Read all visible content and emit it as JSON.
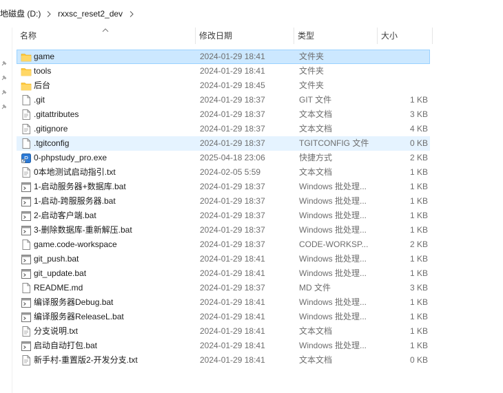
{
  "breadcrumb": {
    "drive": "地磁盘 (D:)",
    "folder": "rxxsc_reset2_dev"
  },
  "columns": {
    "name": "名称",
    "date": "修改日期",
    "type": "类型",
    "size": "大小"
  },
  "sort": {
    "column": "name",
    "direction": "ascending"
  },
  "colors": {
    "selected_bg": "#cce8ff",
    "selected_border": "#99d1ff",
    "hover_bg": "#e5f3ff",
    "folder": "#ffc83d"
  },
  "files": [
    {
      "name": "game",
      "date": "2024-01-29 18:41",
      "type": "文件夹",
      "size": "",
      "icon": "folder-icon",
      "state": "selected"
    },
    {
      "name": "tools",
      "date": "2024-01-29 18:41",
      "type": "文件夹",
      "size": "",
      "icon": "folder-icon",
      "state": ""
    },
    {
      "name": "后台",
      "date": "2024-01-29 18:45",
      "type": "文件夹",
      "size": "",
      "icon": "folder-icon",
      "state": ""
    },
    {
      "name": ".git",
      "date": "2024-01-29 18:37",
      "type": "GIT 文件",
      "size": "1 KB",
      "icon": "file-icon",
      "state": ""
    },
    {
      "name": ".gitattributes",
      "date": "2024-01-29 18:37",
      "type": "文本文档",
      "size": "3 KB",
      "icon": "text-file-icon",
      "state": ""
    },
    {
      "name": ".gitignore",
      "date": "2024-01-29 18:37",
      "type": "文本文档",
      "size": "4 KB",
      "icon": "text-file-icon",
      "state": ""
    },
    {
      "name": ".tgitconfig",
      "date": "2024-01-29 18:37",
      "type": "TGITCONFIG 文件",
      "size": "0 KB",
      "icon": "file-icon",
      "state": "hover"
    },
    {
      "name": "0-phpstudy_pro.exe",
      "date": "2025-04-18 23:06",
      "type": "快捷方式",
      "size": "2 KB",
      "icon": "shortcut-icon",
      "state": ""
    },
    {
      "name": "0本地测试启动指引.txt",
      "date": "2024-02-05 5:59",
      "type": "文本文档",
      "size": "1 KB",
      "icon": "text-file-icon",
      "state": ""
    },
    {
      "name": "1-启动服务器+数据库.bat",
      "date": "2024-01-29 18:37",
      "type": "Windows 批处理...",
      "size": "1 KB",
      "icon": "batch-file-icon",
      "state": ""
    },
    {
      "name": "1-启动-跨服服务器.bat",
      "date": "2024-01-29 18:37",
      "type": "Windows 批处理...",
      "size": "1 KB",
      "icon": "batch-file-icon",
      "state": ""
    },
    {
      "name": "2-启动客户端.bat",
      "date": "2024-01-29 18:37",
      "type": "Windows 批处理...",
      "size": "1 KB",
      "icon": "batch-file-icon",
      "state": ""
    },
    {
      "name": "3-删除数据库-重新解压.bat",
      "date": "2024-01-29 18:37",
      "type": "Windows 批处理...",
      "size": "1 KB",
      "icon": "batch-file-icon",
      "state": ""
    },
    {
      "name": "game.code-workspace",
      "date": "2024-01-29 18:37",
      "type": "CODE-WORKSP...",
      "size": "2 KB",
      "icon": "file-icon",
      "state": ""
    },
    {
      "name": "git_push.bat",
      "date": "2024-01-29 18:41",
      "type": "Windows 批处理...",
      "size": "1 KB",
      "icon": "batch-file-icon",
      "state": ""
    },
    {
      "name": "git_update.bat",
      "date": "2024-01-29 18:41",
      "type": "Windows 批处理...",
      "size": "1 KB",
      "icon": "batch-file-icon",
      "state": ""
    },
    {
      "name": "README.md",
      "date": "2024-01-29 18:37",
      "type": "MD 文件",
      "size": "3 KB",
      "icon": "file-icon",
      "state": ""
    },
    {
      "name": "编译服务器Debug.bat",
      "date": "2024-01-29 18:41",
      "type": "Windows 批处理...",
      "size": "1 KB",
      "icon": "batch-file-icon",
      "state": ""
    },
    {
      "name": "编译服务器ReleaseL.bat",
      "date": "2024-01-29 18:41",
      "type": "Windows 批处理...",
      "size": "1 KB",
      "icon": "batch-file-icon",
      "state": ""
    },
    {
      "name": "分支说明.txt",
      "date": "2024-01-29 18:41",
      "type": "文本文档",
      "size": "1 KB",
      "icon": "text-file-icon",
      "state": ""
    },
    {
      "name": "启动自动打包.bat",
      "date": "2024-01-29 18:41",
      "type": "Windows 批处理...",
      "size": "1 KB",
      "icon": "batch-file-icon",
      "state": ""
    },
    {
      "name": "新手村-重置版2-开发分支.txt",
      "date": "2024-01-29 18:41",
      "type": "文本文档",
      "size": "0 KB",
      "icon": "text-file-icon",
      "state": ""
    }
  ]
}
